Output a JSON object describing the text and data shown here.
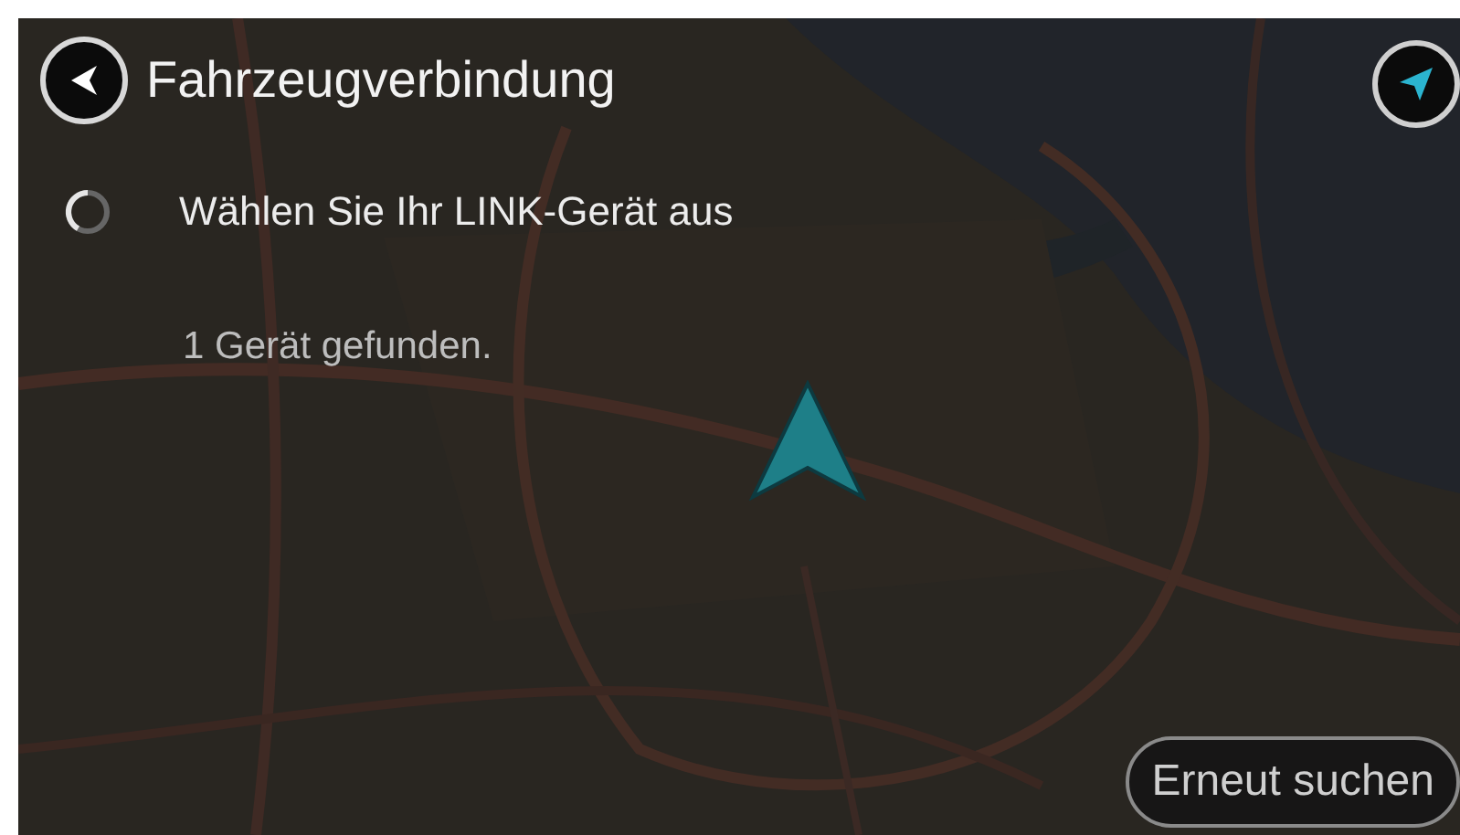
{
  "header": {
    "title": "Fahrzeugverbindung"
  },
  "status": {
    "message": "Wählen Sie Ihr LINK-Gerät aus",
    "busy": true
  },
  "result": "1 Gerät gefunden.",
  "buttons": [
    {
      "label": "Erneut suchen"
    }
  ]
}
